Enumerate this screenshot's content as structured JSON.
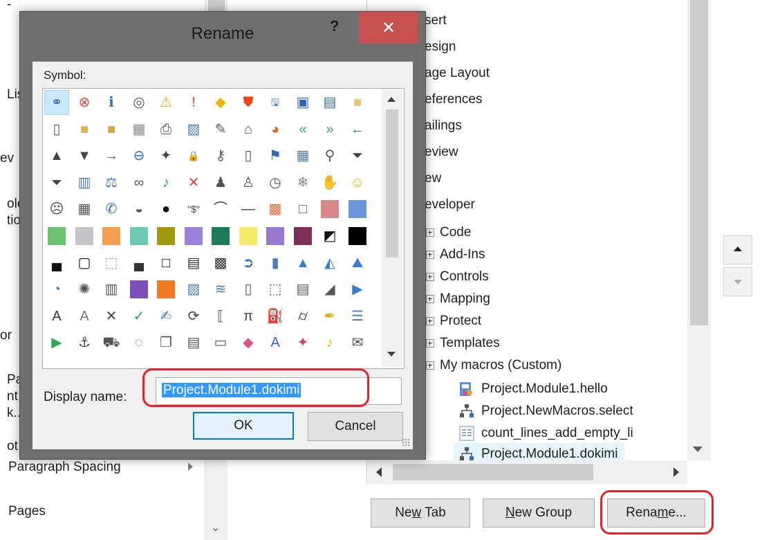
{
  "left_panel": {
    "fragments": [
      "-",
      "Lis",
      "ev",
      "ole",
      "tio",
      "or",
      "Pai",
      "nt",
      "k..",
      "ot"
    ],
    "items": [
      {
        "label": "Paragraph Spacing"
      },
      {
        "label": "Pages"
      }
    ]
  },
  "tree": {
    "tabs": [
      {
        "label": "sert"
      },
      {
        "label": "esign"
      },
      {
        "label": "age Layout"
      },
      {
        "label": "eferences"
      },
      {
        "label": "ailings"
      },
      {
        "label": "eview"
      },
      {
        "label": "ew"
      },
      {
        "label": "eveloper"
      }
    ],
    "groups": [
      {
        "label": "Code"
      },
      {
        "label": "Add-Ins"
      },
      {
        "label": "Controls"
      },
      {
        "label": "Mapping"
      },
      {
        "label": "Protect"
      },
      {
        "label": "Templates"
      },
      {
        "label": "My macros (Custom)"
      }
    ],
    "macros": [
      {
        "label": "Project.Module1.hello",
        "icon": "flowchart-document-icon"
      },
      {
        "label": "Project.NewMacros.select",
        "icon": "org-chart-icon"
      },
      {
        "label": "count_lines_add_empty_li",
        "icon": "document-list-icon"
      },
      {
        "label": "Project.Module1.dokimi",
        "icon": "org-chart-icon",
        "selected": true
      }
    ]
  },
  "buttons": {
    "new_tab": {
      "pre": "Ne",
      "key": "w",
      "post": " Tab"
    },
    "new_group": {
      "pre": "",
      "key": "N",
      "post": "ew Group"
    },
    "rename": {
      "pre": "Rena",
      "key": "m",
      "post": "e..."
    }
  },
  "dialog": {
    "title": "Rename",
    "help_label": "?",
    "close_label": "✕",
    "symbol_label": "Symbol:",
    "display_name_label": "Display name:",
    "display_name_value": "Project.Module1.dokimi",
    "ok_label": "OK",
    "cancel_label": "Cancel"
  },
  "symbols": [
    {
      "g": "org-chart",
      "t": "⚭",
      "c": "#3d6bb3",
      "sel": true
    },
    {
      "g": "error",
      "t": "⊗",
      "c": "#d9453c"
    },
    {
      "g": "info",
      "t": "ℹ",
      "c": "#2a6ebb"
    },
    {
      "g": "stop-circle",
      "t": "◎",
      "c": "#5a5a5a"
    },
    {
      "g": "warning",
      "t": "⚠",
      "c": "#e8a317"
    },
    {
      "g": "exclamation",
      "t": "!",
      "c": "#d9453c"
    },
    {
      "g": "diamond-warning",
      "t": "◆",
      "c": "#f0b400"
    },
    {
      "g": "shield",
      "t": "⛊",
      "c": "#e64a19"
    },
    {
      "g": "save",
      "t": "🖫",
      "c": "#3064b6"
    },
    {
      "g": "save-all",
      "t": "▣",
      "c": "#3064b6"
    },
    {
      "g": "save-as",
      "t": "▤",
      "c": "#3064b6"
    },
    {
      "g": "folder",
      "t": "■",
      "c": "#e8c46a"
    },
    {
      "g": "new-document",
      "t": "▯",
      "c": "#555555"
    },
    {
      "g": "open-folder",
      "t": "■",
      "c": "#e0b04a"
    },
    {
      "g": "folder-up",
      "t": "■",
      "c": "#d8a640"
    },
    {
      "g": "folder-list",
      "t": "▦",
      "c": "#888888"
    },
    {
      "g": "print",
      "t": "⎙",
      "c": "#555555"
    },
    {
      "g": "picture",
      "t": "▨",
      "c": "#4a7bb7"
    },
    {
      "g": "document-edit",
      "t": "✎",
      "c": "#555555"
    },
    {
      "g": "home",
      "t": "⌂",
      "c": "#555555"
    },
    {
      "g": "pie-chart",
      "t": "◕",
      "c": "#e85d2a"
    },
    {
      "g": "back-double",
      "t": "«",
      "c": "#3aa655"
    },
    {
      "g": "forward-double",
      "t": "»",
      "c": "#3aa655"
    },
    {
      "g": "back-arrow",
      "t": "←",
      "c": "#2a6ebb"
    },
    {
      "g": "triangle-up",
      "t": "▲",
      "c": "#444444"
    },
    {
      "g": "triangle-down",
      "t": "▼",
      "c": "#444444"
    },
    {
      "g": "arrow-right",
      "t": "→",
      "c": "#2a6ebb"
    },
    {
      "g": "circle-back",
      "t": "⊖",
      "c": "#2a6ebb"
    },
    {
      "g": "pin",
      "t": "✦",
      "c": "#444444"
    },
    {
      "g": "lock",
      "t": "🔒",
      "c": "#e0a030"
    },
    {
      "g": "key",
      "t": "⚷",
      "c": "#555555"
    },
    {
      "g": "mobile",
      "t": "▯",
      "c": "#555555"
    },
    {
      "g": "flag",
      "t": "⚑",
      "c": "#2a6ebb"
    },
    {
      "g": "calendar",
      "t": "▦",
      "c": "#5a7fa8"
    },
    {
      "g": "magnifier",
      "t": "⚲",
      "c": "#555555"
    },
    {
      "g": "filter",
      "t": "⏷",
      "c": "#444444"
    },
    {
      "g": "filter-2",
      "t": "⏷",
      "c": "#444444"
    },
    {
      "g": "book",
      "t": "▥",
      "c": "#4a7bb7"
    },
    {
      "g": "scales",
      "t": "⚖",
      "c": "#4a7bb7"
    },
    {
      "g": "rings",
      "t": "∞",
      "c": "#555555"
    },
    {
      "g": "microphone",
      "t": "♪",
      "c": "#4a7bb7"
    },
    {
      "g": "mute",
      "t": "✕",
      "c": "#d9453c"
    },
    {
      "g": "user-dark",
      "t": "♟",
      "c": "#555555"
    },
    {
      "g": "user",
      "t": "♙",
      "c": "#555555"
    },
    {
      "g": "clock",
      "t": "◷",
      "c": "#555555"
    },
    {
      "g": "snowflake",
      "t": "❄",
      "c": "#888888"
    },
    {
      "g": "hand",
      "t": "✋",
      "c": "#555555"
    },
    {
      "g": "smiley",
      "t": "☺",
      "c": "#e6b800"
    },
    {
      "g": "sad-face",
      "t": "☹",
      "c": "#444444"
    },
    {
      "g": "calculator",
      "t": "▦",
      "c": "#555555"
    },
    {
      "g": "phone",
      "t": "✆",
      "c": "#3064b6"
    },
    {
      "g": "piggy-bank",
      "t": "◒",
      "c": "#555555"
    },
    {
      "g": "eight-ball",
      "t": "●",
      "c": "#111111"
    },
    {
      "g": "quote-dollar",
      "t": "\"$\"",
      "c": "#444444"
    },
    {
      "g": "eye",
      "t": "⌒",
      "c": "#444444"
    },
    {
      "g": "dash",
      "t": "—",
      "c": "#444444"
    },
    {
      "g": "tiles",
      "t": "▩",
      "c": "#e86a3a"
    },
    {
      "g": "square-outline",
      "t": "□",
      "c": "#555555"
    },
    {
      "g": "square-rose",
      "sw": "#d9888a"
    },
    {
      "g": "square-blue",
      "sw": "#6b95dc"
    },
    {
      "g": "square-green",
      "sw": "#6cc471"
    },
    {
      "g": "square-gray",
      "sw": "#c2c2c8"
    },
    {
      "g": "square-orange",
      "sw": "#f0a050"
    },
    {
      "g": "square-teal",
      "sw": "#70c8b4"
    },
    {
      "g": "square-olive",
      "sw": "#a09a10"
    },
    {
      "g": "square-purple",
      "sw": "#9c80d8"
    },
    {
      "g": "square-darkgreen",
      "sw": "#1e7a5a"
    },
    {
      "g": "square-yellow",
      "sw": "#f4e86a"
    },
    {
      "g": "square-violet",
      "sw": "#9a7ad0"
    },
    {
      "g": "square-maroon",
      "sw": "#7c3058"
    },
    {
      "g": "half-square",
      "t": "◩",
      "c": "#111111"
    },
    {
      "g": "square-black",
      "sw": "#000000"
    },
    {
      "g": "bottom-bar-square",
      "t": "▄",
      "c": "#111111"
    },
    {
      "g": "square-thick",
      "t": "▢",
      "c": "#111111"
    },
    {
      "g": "square-dotted",
      "t": "⬚",
      "c": "#888888"
    },
    {
      "g": "half-fill",
      "t": "▄",
      "c": "#333333"
    },
    {
      "g": "square-thin",
      "t": "□",
      "c": "#111111"
    },
    {
      "g": "striped-square",
      "t": "▤",
      "c": "#333333"
    },
    {
      "g": "checker",
      "t": "▩",
      "c": "#333333"
    },
    {
      "g": "circle-arrow",
      "t": "➲",
      "c": "#2a6ebb"
    },
    {
      "g": "bar-chart",
      "t": "▮",
      "c": "#4a7bb7"
    },
    {
      "g": "cone",
      "t": "▲",
      "c": "#3a7bd5"
    },
    {
      "g": "triangle-chart",
      "t": "◭",
      "c": "#3a7bd5"
    },
    {
      "g": "mountains",
      "t": "⛰",
      "c": "#3a7bd5"
    },
    {
      "g": "pie-slice",
      "t": "◔",
      "c": "#3a7bd5"
    },
    {
      "g": "radar",
      "t": "✺",
      "c": "#555555"
    },
    {
      "g": "cylinders",
      "t": "▥",
      "c": "#555555"
    },
    {
      "g": "purple-book",
      "sw": "#7b4fb8"
    },
    {
      "g": "orange-doc",
      "sw": "#f07a20"
    },
    {
      "g": "pictures",
      "t": "▨",
      "c": "#4a7bb7"
    },
    {
      "g": "image-wave",
      "t": "≋",
      "c": "#4a7bb7"
    },
    {
      "g": "page",
      "t": "▯",
      "c": "#555555"
    },
    {
      "g": "dotted-frame",
      "t": "⬚",
      "c": "#555555"
    },
    {
      "g": "doc-plus",
      "t": "▤",
      "c": "#555555"
    },
    {
      "g": "pen-frame",
      "t": "◢",
      "c": "#555555"
    },
    {
      "g": "slide",
      "t": "▶",
      "c": "#3a7bd5"
    },
    {
      "g": "text-a",
      "t": "A",
      "c": "#333333"
    },
    {
      "g": "text-a-shaded",
      "t": "A",
      "c": "#777777"
    },
    {
      "g": "cross",
      "t": "✕",
      "c": "#444444"
    },
    {
      "g": "check",
      "t": "✓",
      "c": "#2fa84f"
    },
    {
      "g": "signature",
      "t": "✍",
      "c": "#4a7bb7"
    },
    {
      "g": "refresh",
      "t": "⟳",
      "c": "#444444"
    },
    {
      "g": "brackets",
      "t": "⟦",
      "c": "#555555"
    },
    {
      "g": "pi",
      "t": "π",
      "c": "#444444"
    },
    {
      "g": "paint-bucket",
      "t": "⛽",
      "c": "#e6a700"
    },
    {
      "g": "binoculars",
      "t": "⌭",
      "c": "#333333"
    },
    {
      "g": "brush",
      "t": "✒",
      "c": "#e6a700"
    },
    {
      "g": "list",
      "t": "☰",
      "c": "#4a7bb7"
    },
    {
      "g": "play",
      "t": "▶",
      "c": "#2fa84f"
    },
    {
      "g": "anchor",
      "t": "⚓",
      "c": "#444444"
    },
    {
      "g": "toolbox",
      "t": "⛟",
      "c": "#555555"
    },
    {
      "g": "shape-add",
      "t": "◌",
      "c": "#555555"
    },
    {
      "g": "copy",
      "t": "❐",
      "c": "#555555"
    },
    {
      "g": "document",
      "t": "▤",
      "c": "#555555"
    },
    {
      "g": "folder-outline",
      "t": "▭",
      "c": "#555555"
    },
    {
      "g": "eraser",
      "t": "◆",
      "c": "#e0508a"
    },
    {
      "g": "italic-a",
      "t": "A",
      "c": "#3a5fd5"
    },
    {
      "g": "butterfly",
      "t": "✦",
      "c": "#d93a6a"
    },
    {
      "g": "bell",
      "t": "♪",
      "c": "#e6b800"
    },
    {
      "g": "envelope",
      "t": "✉",
      "c": "#555555"
    }
  ]
}
